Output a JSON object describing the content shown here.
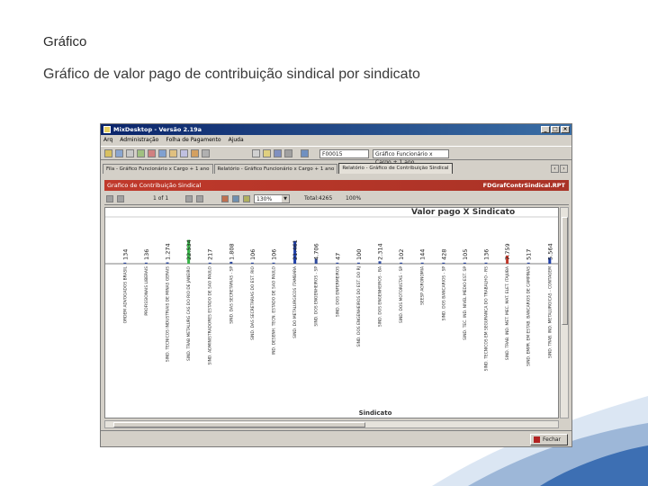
{
  "slide": {
    "title": "Gráfico",
    "subtitle": "Gráfico de valor pago de contribuição sindical por sindicato"
  },
  "window": {
    "title": "MixDesktop - Versão 2.19a",
    "menu": [
      "Arq",
      "Administração",
      "Folha de Pagamento",
      "Ajuda"
    ],
    "toolbar": {
      "filial_value": "F00015",
      "view_value": "Gráfico Funcionário x Cargo + 1 ano"
    },
    "tabs": [
      "Fila - Gráfico Funcionário x Cargo + 1 ano",
      "Relatório - Gráfico Funcionário x Cargo + 1 ano",
      "Relatório - Gráfico de Contribuição Sindical"
    ],
    "active_tab": 2,
    "report_header": "Grafico de Contribuição Sindical",
    "report_id": "FDGrafContrSindical.RPT",
    "page_indicator": "1 of 1",
    "zoom": "130%",
    "total_label": "Total:4265",
    "percent_label": "100%",
    "close_label": "Fechar"
  },
  "chart_data": {
    "type": "bar",
    "title": "Valor pago X Sindicato",
    "xlabel": "Sindicato",
    "categories": [
      "ORDEM ADVOGADOS BRASIL",
      "PROFISSIONAIS LIBERAIS",
      "SIND. TECNICOS INDUSTRIAIS DE MINAS GERAIS",
      "SIND. TRAB METALURG CAS DO RIO DE JANEIRO",
      "SIND. ADMINISTRADORES ESTADO DE SAO PAULO",
      "SIND. DAS SECRETARIAS - SP",
      "SIND. DAS SECRETARIAS DO EST. RIO",
      "IND. DESENH. TECN. ESTADO DE SAO PAULO",
      "SIND. DO METALURGICOS ITAMBARA",
      "SIND. DOS ENGENHEIROS - SP",
      "SIND. DOS ENFERMEIROS",
      "SIND. DOS ENGENHEIROS DO EST. DO RJ",
      "SIND. DOS ENGENHEIROS - BA",
      "SIND. DOS MOTORISTAS - SP",
      "SEESP AGRONOMIA",
      "SIND. DOS BANCARIOS - SP",
      "SIND. TEC. IND. NIVEL MEDIO EST. SP",
      "SIND. TECNICOS EM SEGURANCA DO TRABALHO - RS",
      "SIND. TRAB. IND. MET. MEC. MAT. ELET. ITAJUBA",
      "SIND. EMPR. EM ESTAB. BANCARIOS DE CAMPINAS",
      "SIND. TRAB. IND. METALURGICAS - CONTAGEM"
    ],
    "values": [
      134,
      136,
      1274,
      22534,
      217,
      1808,
      106,
      106,
      21461,
      4706,
      47,
      100,
      2314,
      102,
      144,
      428,
      105,
      136,
      7759,
      517,
      5564
    ],
    "value_labels": [
      "134",
      "136",
      "1.274",
      "22.534",
      "217",
      "1.808",
      "106",
      "106",
      "21.461",
      "4.706",
      "47",
      "100",
      "2.314",
      "102",
      "144",
      "428",
      "105",
      "136",
      "7.759",
      "517",
      "5.564"
    ],
    "bar_colors": [
      "#2e4a9e",
      "#2e4a9e",
      "#2e4a9e",
      "#3ab54a",
      "#2e4a9e",
      "#2e4a9e",
      "#2e4a9e",
      "#2e4a9e",
      "#1f3fa8",
      "#2e4a9e",
      "#2e4a9e",
      "#2e4a9e",
      "#2e4a9e",
      "#2e4a9e",
      "#2e4a9e",
      "#2e4a9e",
      "#2e4a9e",
      "#2e4a9e",
      "#c0392b",
      "#2e4a9e",
      "#1f3fa8"
    ],
    "ylim": [
      0,
      150000
    ],
    "grid": false,
    "legend": "none"
  }
}
